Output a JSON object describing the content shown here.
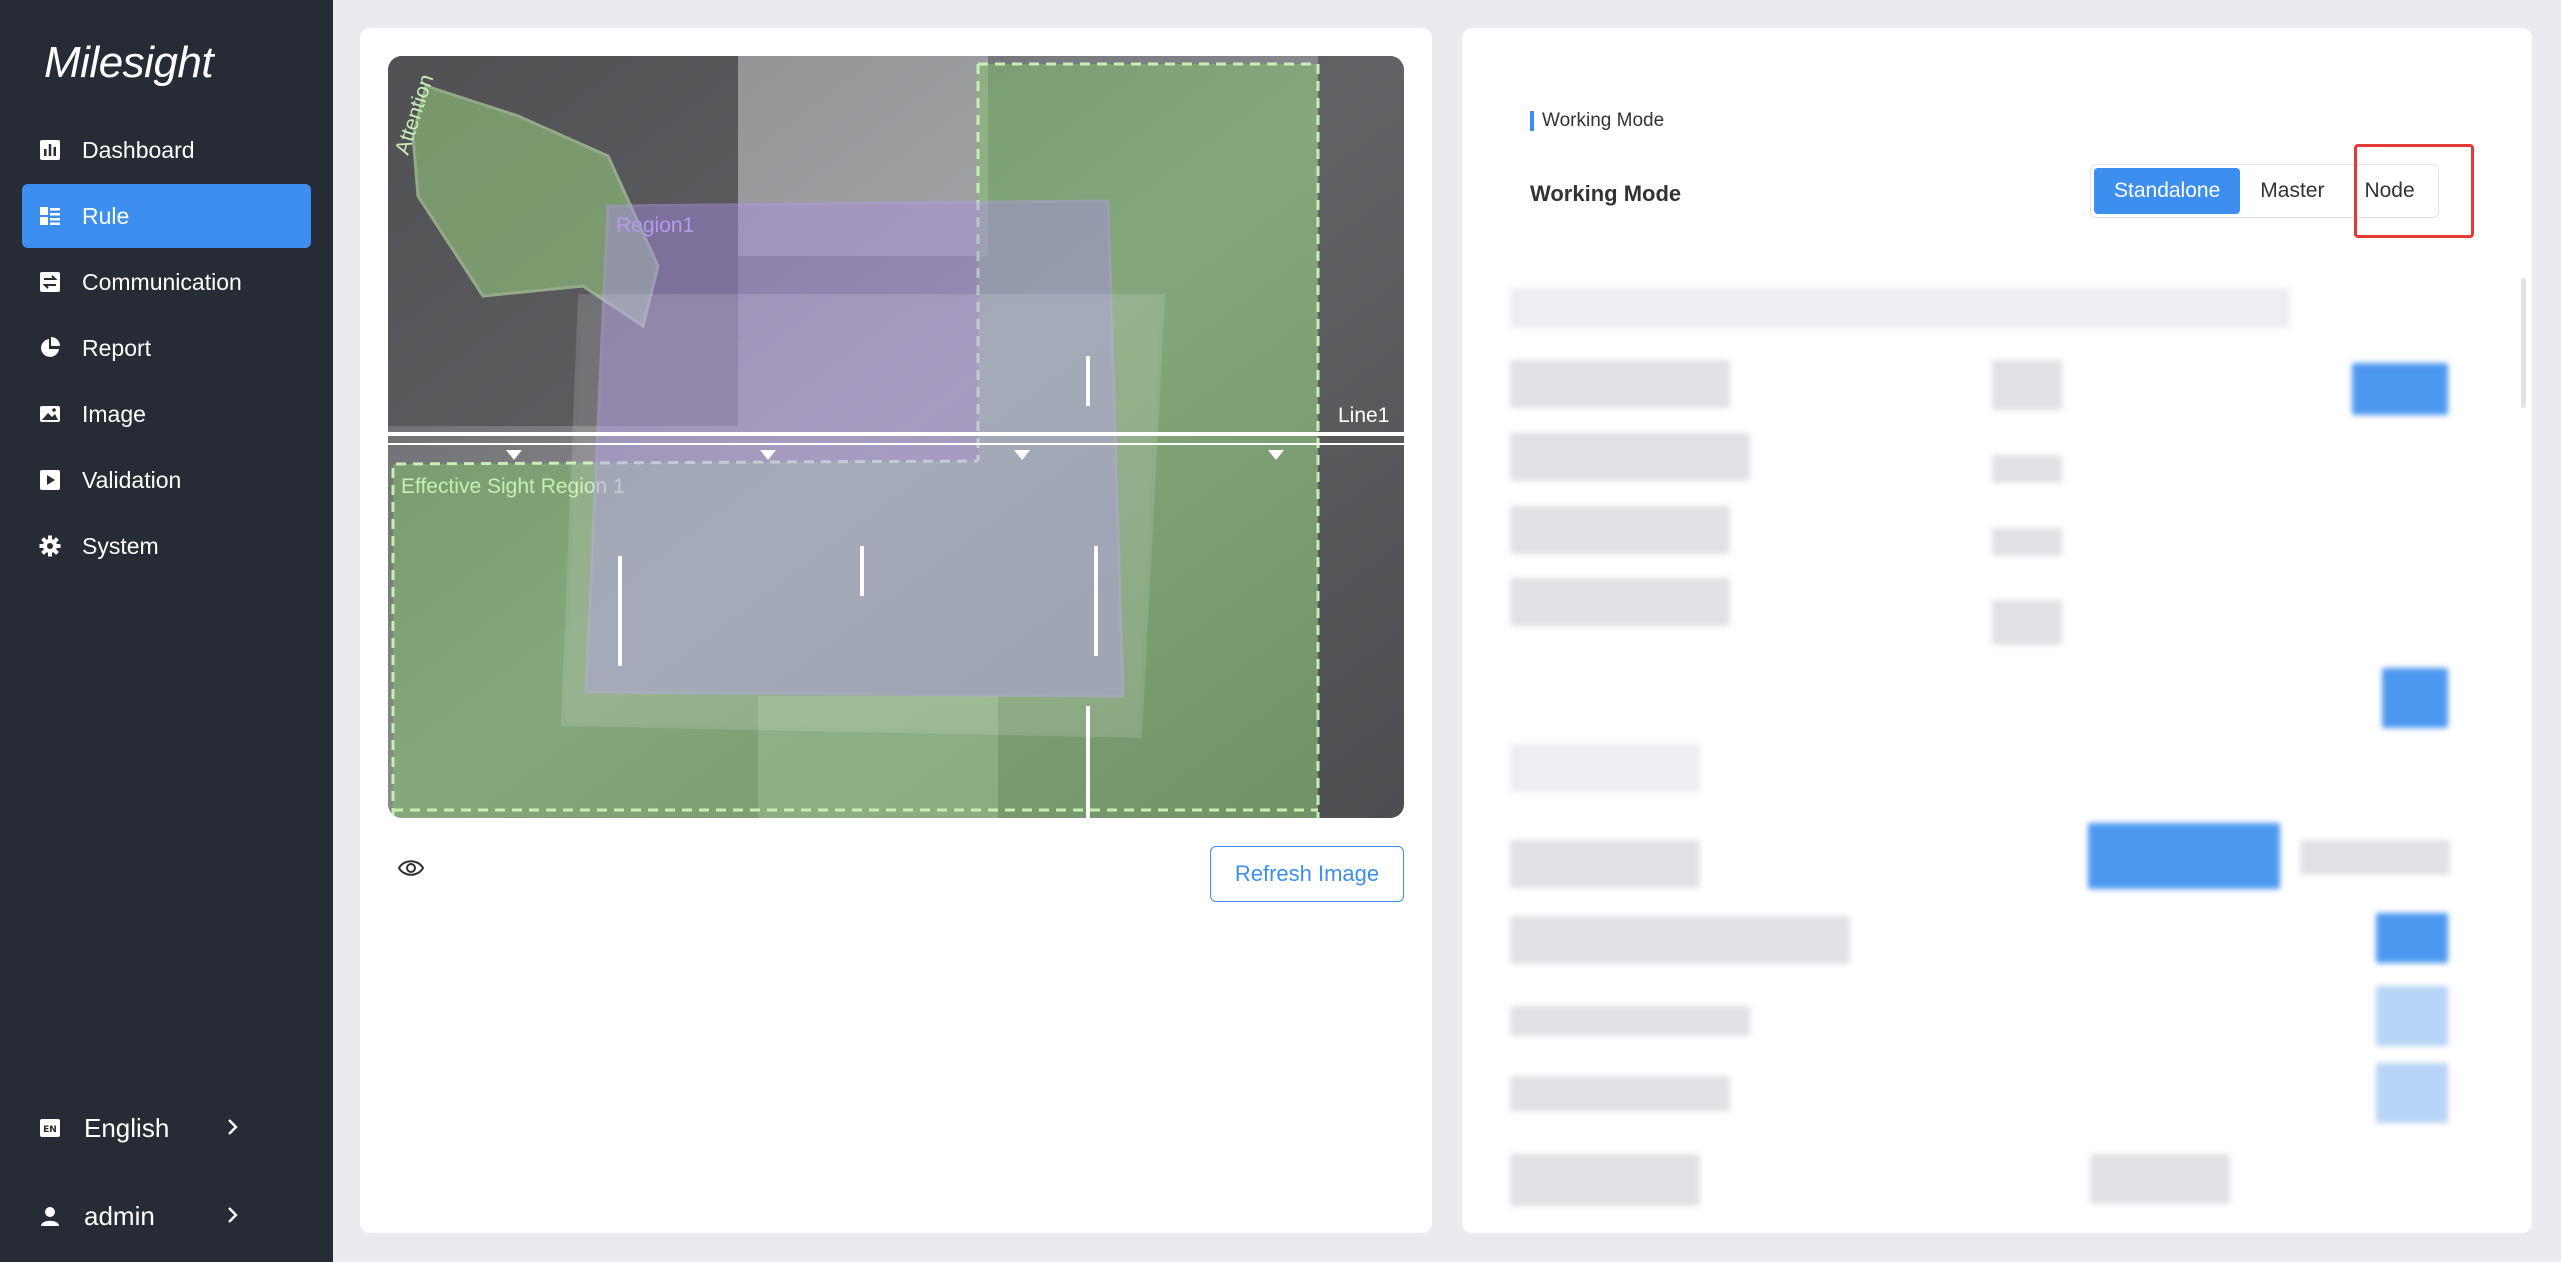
{
  "brand": {
    "logo_text": "Milesight"
  },
  "sidebar": {
    "items": [
      {
        "label": "Dashboard",
        "icon": "bar-chart-icon",
        "active": false
      },
      {
        "label": "Rule",
        "icon": "rule-icon",
        "active": true
      },
      {
        "label": "Communication",
        "icon": "transfer-icon",
        "active": false
      },
      {
        "label": "Report",
        "icon": "pie-chart-icon",
        "active": false
      },
      {
        "label": "Image",
        "icon": "image-icon",
        "active": false
      },
      {
        "label": "Validation",
        "icon": "play-icon",
        "active": false
      },
      {
        "label": "System",
        "icon": "gear-icon",
        "active": false
      }
    ],
    "language": {
      "label": "English",
      "icon": "en-icon"
    },
    "user": {
      "label": "admin",
      "icon": "user-icon"
    }
  },
  "camera": {
    "overlays": {
      "attention": "Attention",
      "region1": "Region1",
      "line1": "Line1",
      "effective_region": "Effective Sight Region 1"
    }
  },
  "left_panel": {
    "refresh_label": "Refresh Image",
    "eye_icon": "eye-icon"
  },
  "working_mode": {
    "section_title": "Working Mode",
    "label": "Working Mode",
    "options": [
      "Standalone",
      "Master",
      "Node"
    ],
    "selected": "Standalone",
    "highlighted": "Node"
  },
  "colors": {
    "sidebar_bg": "#262b36",
    "accent": "#3d8fef",
    "highlight": "#e53935",
    "region_green": "#7fc36a",
    "region_purple": "#a98ee8"
  }
}
